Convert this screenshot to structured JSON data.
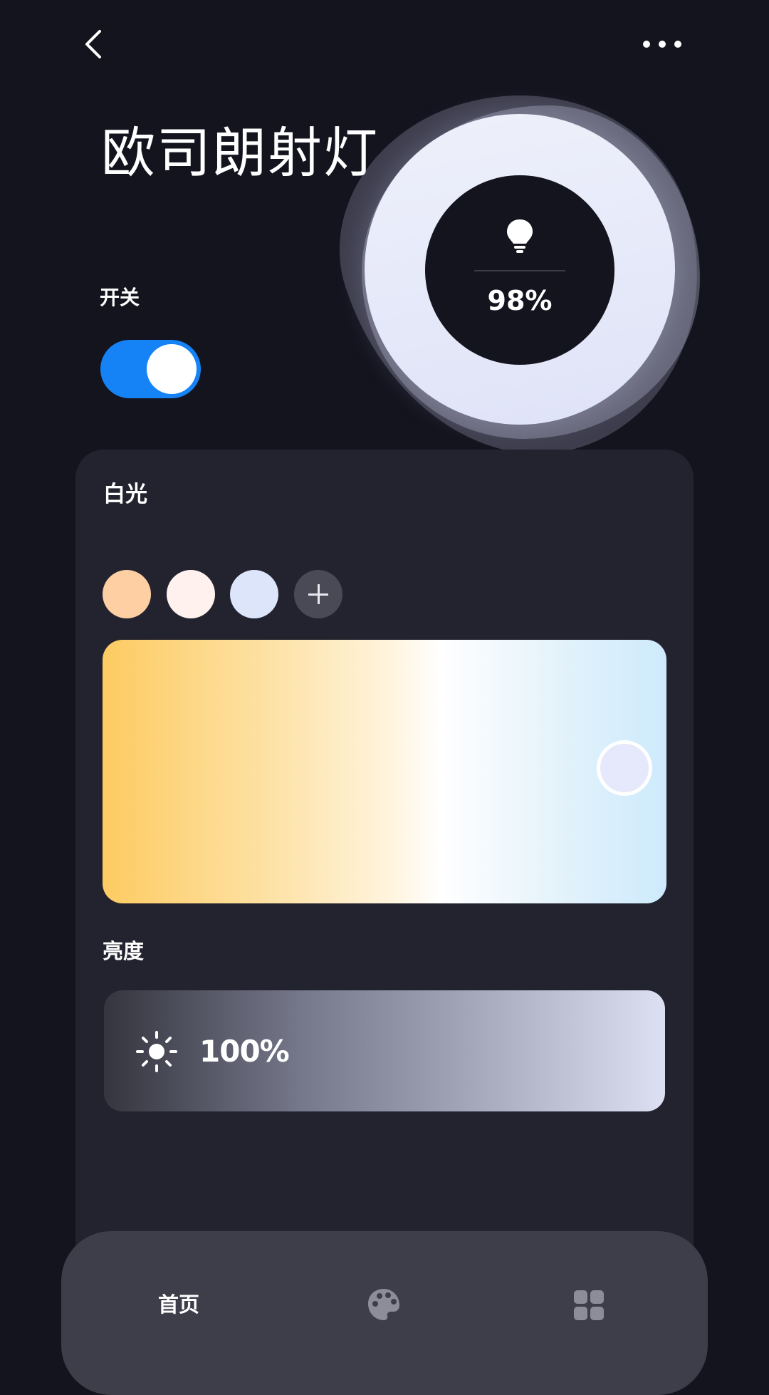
{
  "header": {
    "back_icon": "chevron-left-icon",
    "more_icon": "more-horizontal-icon",
    "title": "欧司朗射灯"
  },
  "power": {
    "label": "开关",
    "on": true,
    "accent_color": "#1583f6"
  },
  "dial": {
    "icon": "lightbulb-icon",
    "value": "98%"
  },
  "white_light": {
    "title": "白光",
    "presets": [
      {
        "color": "#fdcfa2"
      },
      {
        "color": "#fff2ee"
      },
      {
        "color": "#dde5fb"
      }
    ],
    "add_icon": "plus-icon",
    "gradient_colors": [
      "#fdcb62",
      "#ffffff",
      "#cdeafc"
    ]
  },
  "brightness": {
    "title": "亮度",
    "icon": "sun-icon",
    "value": "100%",
    "level": 1.0
  },
  "nav": {
    "home_label": "首页",
    "palette_icon": "palette-icon",
    "grid_icon": "grid-icon"
  }
}
